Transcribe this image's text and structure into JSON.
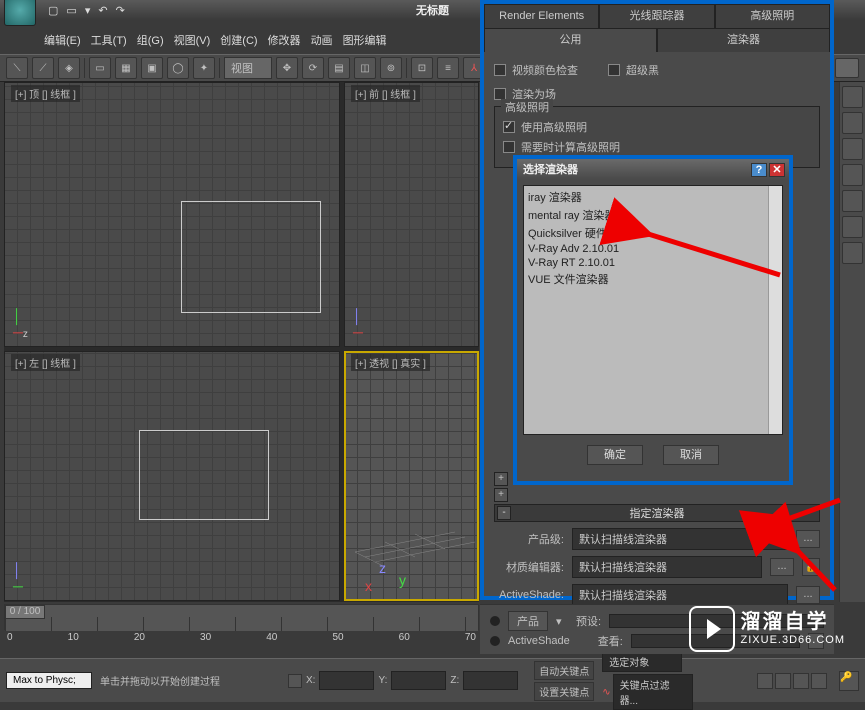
{
  "titlebar": {
    "title": "无标题"
  },
  "menu": {
    "edit": "编辑(E)",
    "tools": "工具(T)",
    "group": "组(G)",
    "views": "视图(V)",
    "create": "创建(C)",
    "modifiers": "修改器",
    "animation": "动画",
    "graph": "图形编辑"
  },
  "toolbar": {
    "view_dropdown": "视图"
  },
  "viewports": {
    "top": "[+] 顶 [] 线框 ]",
    "front": "[+] 前 [] 线框 ]",
    "left": "[+] 左 [] 线框 ]",
    "persp": "[+] 透视 [] 真实 ]"
  },
  "timeframe": {
    "slider": "0 / 100",
    "t0": "0",
    "t1": "10",
    "t2": "20",
    "t3": "30",
    "t4": "40",
    "t5": "50",
    "t6": "60",
    "t7": "70"
  },
  "render": {
    "tab_elements": "Render Elements",
    "tab_raytrace": "光线跟踪器",
    "tab_adv_light": "高级照明",
    "tab_common": "公用",
    "tab_renderer": "渲染器",
    "checkbox1": "视频颜色检查",
    "checkbox2": "超级黑",
    "checkbox3": "渲染为场",
    "group_adv": "高级照明",
    "chk_use_adv": "使用高级照明",
    "chk_compute_adv": "需要时计算高级照明",
    "rollout_assign": "指定渲染器",
    "row_production": "产品级:",
    "row_material": "材质编辑器:",
    "row_activeshade": "ActiveShade:",
    "field_value": "默认扫描线渲染器",
    "save_default": "保存为默认设置",
    "btn_production": "产品",
    "preset_lbl": "预设:",
    "active_shade": "ActiveShade",
    "view_lbl": "查看:"
  },
  "chooser": {
    "title": "选择渲染器",
    "items": {
      "iray": "iray 渲染器",
      "mentalray": "mental ray 渲染器",
      "quicksilver": "Quicksilver 硬件渲染器",
      "vray_adv": "V-Ray Adv 2.10.01",
      "vray_rt": "V-Ray RT 2.10.01",
      "vue": "VUE 文件渲染器"
    },
    "ok": "确定",
    "cancel": "取消"
  },
  "status": {
    "script": "Max to Physc;",
    "prompt": "单击并拖动以开始创建过程",
    "x": "X:",
    "y": "Y:",
    "z": "Z:",
    "autokey": "自动关键点",
    "setkey": "设置关键点",
    "selected": "选定对象",
    "keyfilter": "关键点过滤器..."
  },
  "watermark": {
    "big": "溜溜自学",
    "small": "ZIXUE.3D66.COM"
  }
}
